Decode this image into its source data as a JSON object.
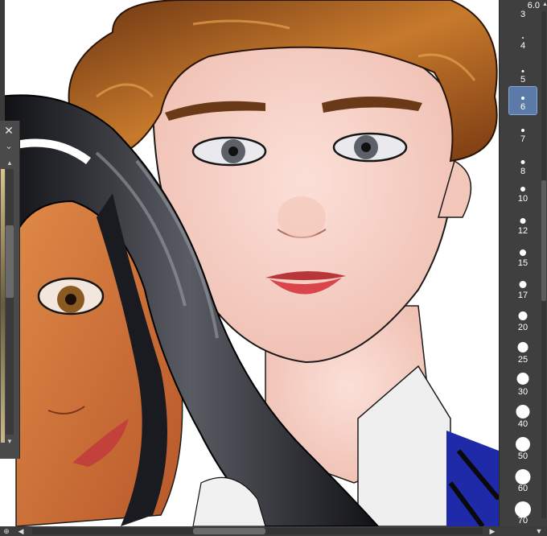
{
  "brush_panel": {
    "current_size": "6.0",
    "selected_size": "6",
    "sizes": [
      "3",
      "4",
      "5",
      "6",
      "7",
      "8",
      "10",
      "12",
      "15",
      "17",
      "20",
      "25",
      "30",
      "40",
      "50",
      "60",
      "70"
    ]
  },
  "left_panel": {
    "close_icon": "close-icon",
    "collapse_icon": "chevron-down-icon"
  },
  "colors": {
    "panel_bg": "#3f3f3f",
    "selected": "#5b7aa8",
    "skin_light": "#f6d2c8",
    "hair_brown": "#8a4a1e",
    "hair_black": "#1b1c20",
    "skin_tan": "#d9783a"
  }
}
